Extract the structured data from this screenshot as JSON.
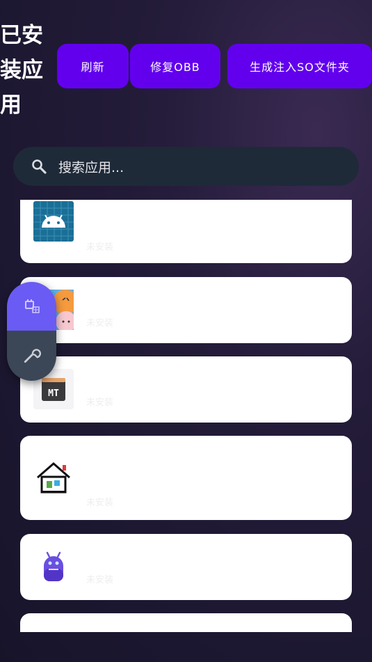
{
  "header": {
    "title": "已安装应用",
    "buttons": [
      {
        "label": "刷新"
      },
      {
        "label": "修复OBB"
      },
      {
        "label": "生成注入SO文件夹"
      }
    ]
  },
  "search": {
    "placeholder": "搜索应用..."
  },
  "apps": [
    {
      "icon": "android-icon",
      "status": "未安装"
    },
    {
      "icon": "cartoon-faces-icon",
      "status": "未安装"
    },
    {
      "icon": "mt-manager-icon",
      "status": "未安装"
    },
    {
      "icon": "pixel-house-icon",
      "status": "未安装"
    },
    {
      "icon": "robot-icon",
      "status": "未安装"
    }
  ],
  "fab": {
    "top_icon": "plugin-icon",
    "bottom_icon": "wrench-icon"
  },
  "colors": {
    "accent": "#6200ee",
    "search_bg": "#1f2a38",
    "fab_top": "#6a5bf4",
    "fab_bottom": "#3b4656"
  }
}
